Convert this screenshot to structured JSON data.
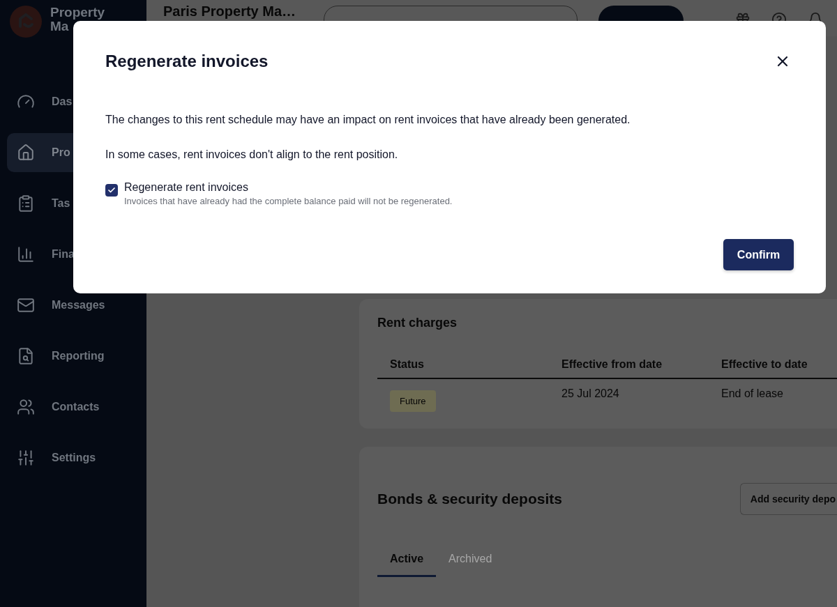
{
  "sidebar": {
    "logo_lines": [
      "Property",
      "Ma"
    ],
    "items": [
      {
        "label": "Das",
        "selected": false
      },
      {
        "label": "Pro",
        "selected": true
      },
      {
        "label": "Tas",
        "selected": false
      },
      {
        "label": "Fina",
        "selected": false
      },
      {
        "label": "Messages",
        "selected": false
      },
      {
        "label": "Reporting",
        "selected": false
      },
      {
        "label": "Contacts",
        "selected": false
      },
      {
        "label": "Settings",
        "selected": false
      }
    ]
  },
  "header": {
    "title": "Paris Property Ma…"
  },
  "rent_charges": {
    "title": "Rent charges",
    "columns": [
      "Status",
      "Effective from date",
      "Effective to date"
    ],
    "rows": [
      {
        "status": "Future",
        "from": "25 Jul 2024",
        "to": "End of lease"
      }
    ]
  },
  "bonds": {
    "title": "Bonds & security deposits",
    "add_button": "Add security depo",
    "tabs": [
      {
        "label": "Active",
        "selected": true
      },
      {
        "label": "Archived",
        "selected": false
      }
    ]
  },
  "modal": {
    "title": "Regenerate invoices",
    "paragraphs": [
      "The changes to this rent schedule may have an impact on rent invoices that have already been generated.",
      "In some cases, rent invoices don't align to the rent position."
    ],
    "option": {
      "label": "Regenerate rent invoices",
      "hint": "Invoices that have already had the complete balance paid will not be regenerated.",
      "checked": true
    },
    "confirm": "Confirm"
  }
}
